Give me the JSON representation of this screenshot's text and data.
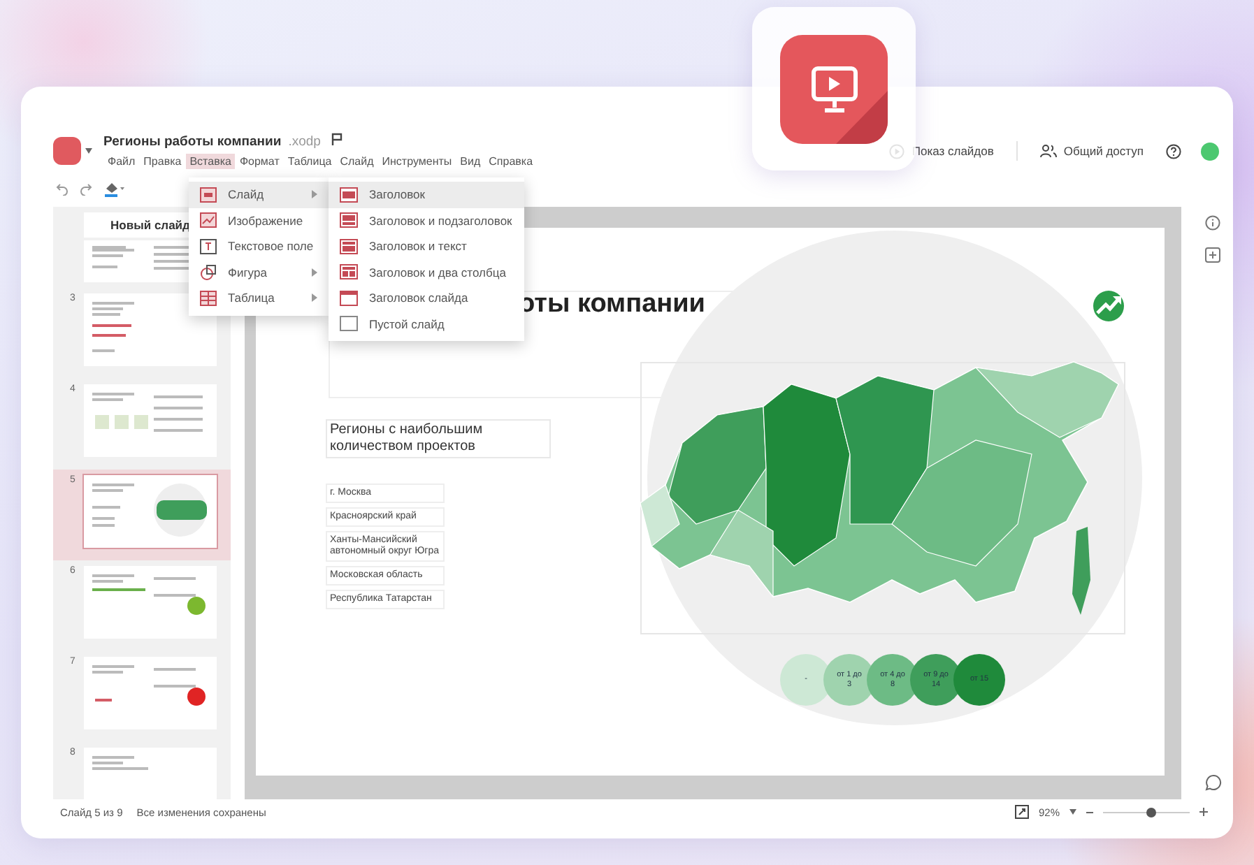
{
  "document": {
    "title": "Регионы работы компании",
    "extension": ".xodp"
  },
  "menu_bar": [
    {
      "label": "Файл",
      "selected": false
    },
    {
      "label": "Правка",
      "selected": false
    },
    {
      "label": "Вставка",
      "selected": true
    },
    {
      "label": "Формат",
      "selected": false
    },
    {
      "label": "Таблица",
      "selected": false
    },
    {
      "label": "Слайд",
      "selected": false
    },
    {
      "label": "Инструменты",
      "selected": false
    },
    {
      "label": "Вид",
      "selected": false
    },
    {
      "label": "Справка",
      "selected": false
    }
  ],
  "header_actions": [
    {
      "label": "Показ слайдов",
      "kind": "play"
    },
    {
      "label": "Общий доступ",
      "kind": "share"
    }
  ],
  "new_slide_button": "Новый слайд",
  "thumbnails": [
    {
      "kind": "text",
      "selected": false
    },
    {
      "number": "3",
      "kind": "money",
      "selected": false
    },
    {
      "number": "4",
      "kind": "chart",
      "selected": false
    },
    {
      "number": "5",
      "kind": "map",
      "selected": true
    },
    {
      "number": "6",
      "kind": "green-badge",
      "selected": false
    },
    {
      "number": "7",
      "kind": "red-badge",
      "selected": false
    },
    {
      "number": "8",
      "kind": "title",
      "selected": false
    }
  ],
  "insert_menu": [
    {
      "label": "Слайд",
      "kind": "slide",
      "submenu": true,
      "selected": true
    },
    {
      "label": "Изображение",
      "kind": "image",
      "submenu": false,
      "selected": false
    },
    {
      "label": "Текстовое поле",
      "kind": "textbox",
      "submenu": false,
      "selected": false
    },
    {
      "label": "Фигура",
      "kind": "shape",
      "submenu": true,
      "selected": false
    },
    {
      "label": "Таблица",
      "kind": "table",
      "submenu": true,
      "selected": false
    }
  ],
  "layout_submenu": [
    {
      "label": "Заголовок",
      "kind": "title",
      "selected": true
    },
    {
      "label": "Заголовок и подзаголовок",
      "kind": "title-sub",
      "selected": false
    },
    {
      "label": "Заголовок и текст",
      "kind": "title-text",
      "selected": false
    },
    {
      "label": "Заголовок и два столбца",
      "kind": "two-col",
      "selected": false
    },
    {
      "label": "Заголовок слайда",
      "kind": "slide-title",
      "selected": false
    },
    {
      "label": "Пустой слайд",
      "kind": "blank",
      "selected": false
    }
  ],
  "slide": {
    "title": "оты компании",
    "subtitle": "Регионы с наибольшим количеством проектов",
    "regions": [
      "г. Москва",
      "Красноярский край",
      "Ханты-Мансийский автономный округ Югра",
      "Московская область",
      "Республика Татарстан"
    ],
    "legend": [
      {
        "label": "-",
        "color": "#cde8d5"
      },
      {
        "label": "от 1 до 3",
        "color": "#9fd3ae"
      },
      {
        "label": "от 4 до 8",
        "color": "#6dbb85"
      },
      {
        "label": "от 9 до 14",
        "color": "#3f9e5b"
      },
      {
        "label": "от 15",
        "color": "#1f8a3b"
      }
    ]
  },
  "status_bar": {
    "slide_counter": "Слайд 5 из 9",
    "save_state": "Все изменения сохранены",
    "zoom": "92%",
    "zoom_slider": {
      "level": 0.55
    }
  }
}
